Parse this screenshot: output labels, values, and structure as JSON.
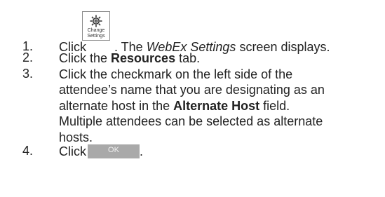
{
  "steps": [
    {
      "number": "1.",
      "before": "Click",
      "button": {
        "icon": "gear-icon",
        "caption_line1": "Change",
        "caption_line2": "Settings"
      },
      "after_plain": ". The ",
      "after_emphasis": "WebEx Settings",
      "after_rest": " screen displays."
    },
    {
      "number": "2.",
      "before": "Click the ",
      "strong": "Resources",
      "after": " tab."
    },
    {
      "number": "3.",
      "lines": [
        "Click the checkmark on the left side of the",
        "attendee’s name that you are designating as an"
      ],
      "line3_before": "alternate host in the ",
      "line3_strong": "Alternate Host",
      "line3_after": " field.",
      "lines_after": [
        "Multiple attendees can be selected as alternate",
        "hosts."
      ]
    },
    {
      "number": "4.",
      "before": "Click",
      "button_label": "OK",
      "after": "."
    }
  ]
}
